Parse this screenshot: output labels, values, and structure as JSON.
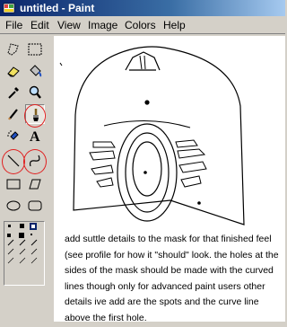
{
  "window": {
    "title": "untitled - Paint"
  },
  "menubar": {
    "items": [
      "File",
      "Edit",
      "View",
      "Image",
      "Colors",
      "Help"
    ]
  },
  "toolbox": {
    "tools": [
      "free-form-select-icon",
      "select-icon",
      "eraser-icon",
      "fill-bucket-icon",
      "color-picker-icon",
      "magnifier-icon",
      "pencil-icon",
      "brush-icon",
      "airbrush-icon",
      "text-icon",
      "line-icon",
      "curve-icon",
      "rectangle-icon",
      "polygon-icon",
      "ellipse-icon",
      "rounded-rectangle-icon"
    ],
    "highlighted_tools": [
      "brush-icon",
      "line-icon",
      "curve-icon"
    ],
    "highlight_color": "#e02020"
  },
  "canvas": {
    "caption": "add suttle details to the mask for that finished feel (see profile for how it \"should\" look. the holes at the sides of the mask should be made with the curved lines though only for advanced paint users other details ive add are the spots and the curve line above the first hole."
  }
}
